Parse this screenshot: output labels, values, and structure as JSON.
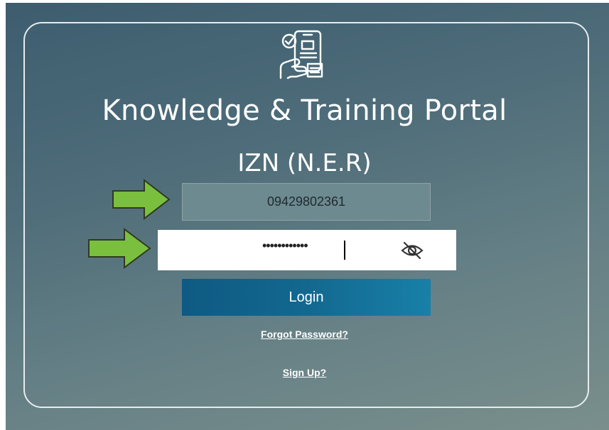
{
  "portal": {
    "title": "Knowledge & Training Portal",
    "subtitle": "IZN (N.E.R)"
  },
  "form": {
    "username_value": "09429802361",
    "password_value": "••••••••••••",
    "login_label": "Login",
    "forgot_label": "Forgot Password?",
    "signup_label": "Sign Up?"
  },
  "icons": {
    "logo": "phone-checklist-hand-icon",
    "password_toggle": "eye-slash-icon",
    "annotation": "green-arrow-icon"
  },
  "colors": {
    "background_top": "#3d5d6f",
    "background_bottom": "#7a8f8c",
    "login_button": "#13688f",
    "annotation_arrow": "#7bbf3f"
  }
}
